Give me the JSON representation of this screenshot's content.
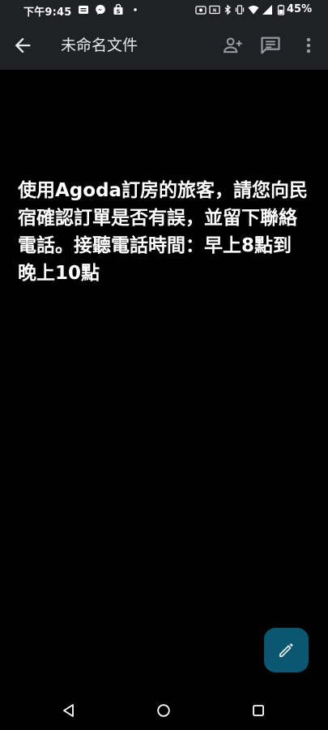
{
  "status_bar": {
    "time": "下午9:45",
    "battery_percent": "45%",
    "left_icons": [
      "notes-icon",
      "messenger-icon",
      "shopping-bag-icon",
      "dot-icon"
    ],
    "right_icons": [
      "screen-record-icon",
      "nfc-icon",
      "bluetooth-icon",
      "vibrate-icon",
      "wifi-icon",
      "signal-icon",
      "battery-icon"
    ]
  },
  "app_bar": {
    "title": "未命名文件",
    "icons": [
      "arrow-back-icon",
      "person-add-icon",
      "comment-icon",
      "more-vert-icon"
    ]
  },
  "document": {
    "text": "使用Agoda訂房的旅客，請您向民宿確認訂單是否有誤，並留下聯絡電話。接聽電話時間：早上8點到晚上10點"
  },
  "fab": {
    "icon": "pencil-icon",
    "color": "#0b5671"
  },
  "nav_bar": {
    "icons": [
      "nav-back-icon",
      "nav-home-icon",
      "nav-recents-icon"
    ]
  }
}
